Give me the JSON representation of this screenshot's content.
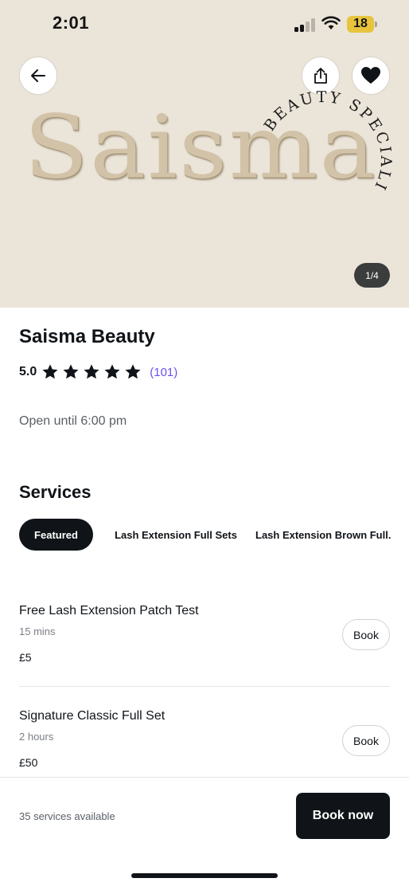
{
  "status_bar": {
    "time": "2:01",
    "battery": "18"
  },
  "hero": {
    "logo_word": "Saisma",
    "logo_tagline": "BEAUTY SPECIALIST",
    "photo_counter": "1/4",
    "icons": {
      "back": "back-arrow-icon",
      "share": "share-icon",
      "favorite": "heart-icon"
    }
  },
  "business": {
    "name": "Saisma Beauty",
    "rating": "5.0",
    "stars": 5,
    "review_count": "(101)",
    "hours": "Open until 6:00 pm"
  },
  "services": {
    "title": "Services",
    "tabs": [
      {
        "label": "Featured",
        "active": true
      },
      {
        "label": "Lash Extension Full Sets",
        "active": false
      },
      {
        "label": "Lash Extension Brown Full...",
        "active": false
      }
    ],
    "items": [
      {
        "name": "Free Lash Extension Patch Test",
        "duration": "15 mins",
        "price": "£5",
        "button": "Book"
      },
      {
        "name": "Signature Classic Full Set",
        "duration": "2 hours",
        "price": "£50",
        "button": "Book"
      }
    ]
  },
  "footer": {
    "services_available": "35 services available",
    "book_now": "Book now"
  },
  "colors": {
    "hero_bg": "#ebe4d9",
    "primary_dark": "#101418",
    "link_purple": "#6950f3",
    "battery_yellow": "#e7c43c"
  }
}
